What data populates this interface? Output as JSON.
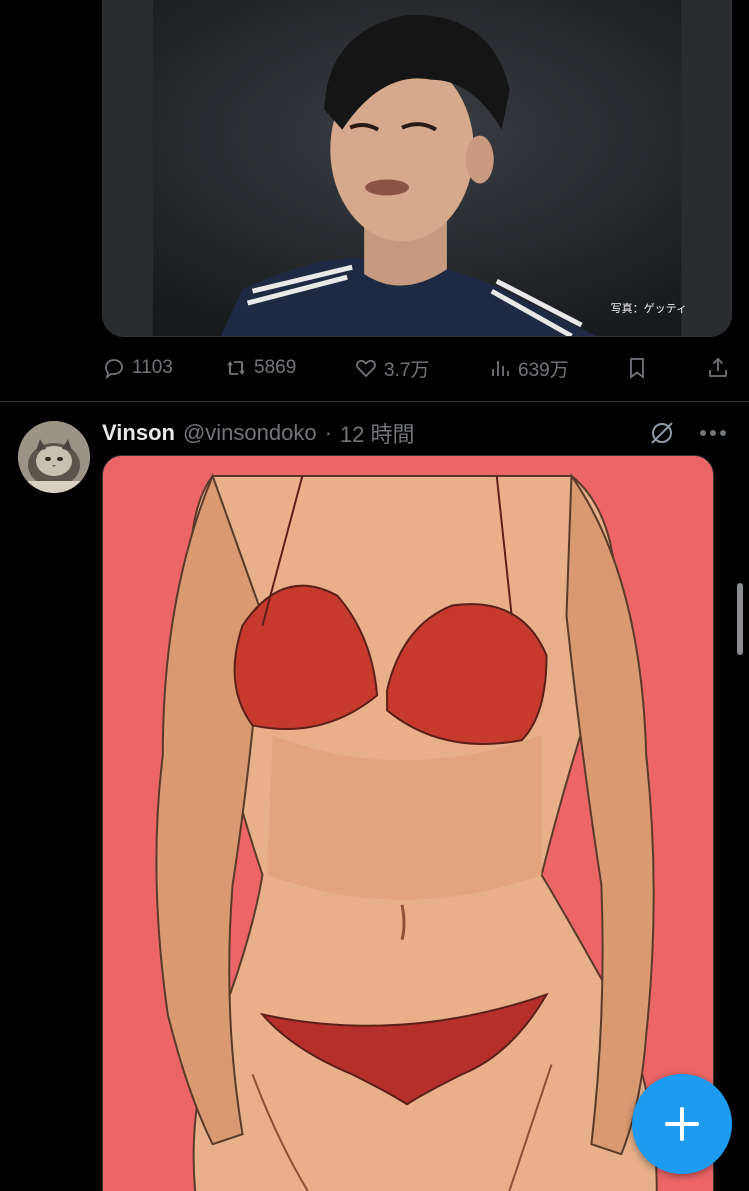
{
  "first_post": {
    "photo_credit": "写真：ゲッティ",
    "actions": {
      "replies": "1103",
      "reposts": "5869",
      "likes": "3.7万",
      "views": "639万"
    }
  },
  "second_post": {
    "display_name": "Vinson",
    "handle": "@vinsondoko",
    "separator": "·",
    "time": "12 時間"
  },
  "colors": {
    "background": "#000000",
    "text_primary": "#e7e9ea",
    "text_secondary": "#71767b",
    "accent": "#1d9bf0",
    "divider": "#2f3336",
    "illustration_background": "#ed6666"
  },
  "icons": {
    "reply": "speech-bubble-icon",
    "repost": "repost-arrows-icon",
    "like": "heart-icon",
    "views": "bar-chart-icon",
    "bookmark": "bookmark-icon",
    "share": "share-upload-icon",
    "grok": "grok-slash-circle-icon",
    "more": "ellipsis-icon",
    "compose": "plus-icon"
  }
}
